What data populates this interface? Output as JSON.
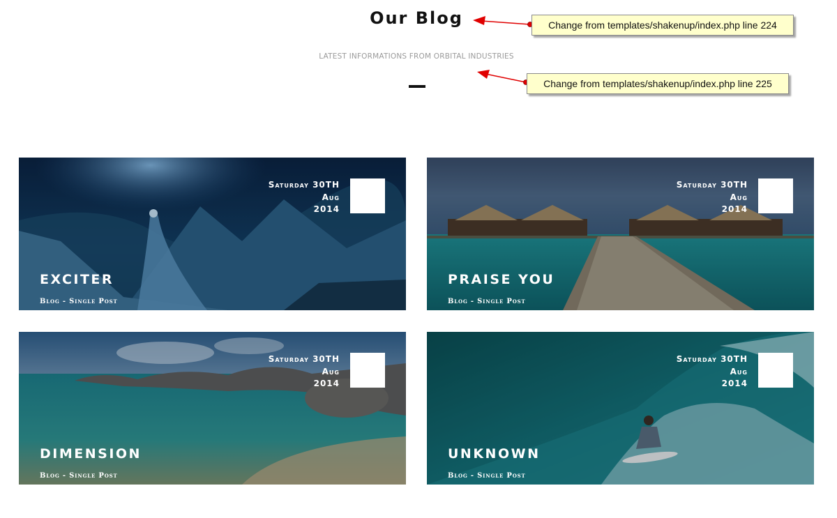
{
  "header": {
    "title": "Our Blog",
    "subtitle": "LATEST INFORMATIONS FROM ORBITAL INDUSTRIES"
  },
  "annotations": [
    {
      "text": "Change from templates/shakenup/index.php line 224"
    },
    {
      "text": "Change from templates/shakenup/index.php line 225"
    }
  ],
  "posts": [
    {
      "title": "EXCITER",
      "date": [
        "Saturday 30TH",
        "Aug",
        "2014"
      ],
      "category": "Blog - Single Post",
      "image": "frozen-queen-snow-mountains"
    },
    {
      "title": "PRAISE YOU",
      "date": [
        "Saturday 30TH",
        "Aug",
        "2014"
      ],
      "category": "Blog - Single Post",
      "image": "overwater-bungalows-pier"
    },
    {
      "title": "DIMENSION",
      "date": [
        "Saturday 30TH",
        "Aug",
        "2014"
      ],
      "category": "Blog - Single Post",
      "image": "tropical-beach-rocks"
    },
    {
      "title": "UNKNOWN",
      "date": [
        "Saturday 30TH",
        "Aug",
        "2014"
      ],
      "category": "Blog - Single Post",
      "image": "surfer-wave"
    }
  ],
  "colors": {
    "note_bg": "#ffffcc",
    "arrow": "#e00000",
    "subtitle": "#9a9a9a"
  }
}
